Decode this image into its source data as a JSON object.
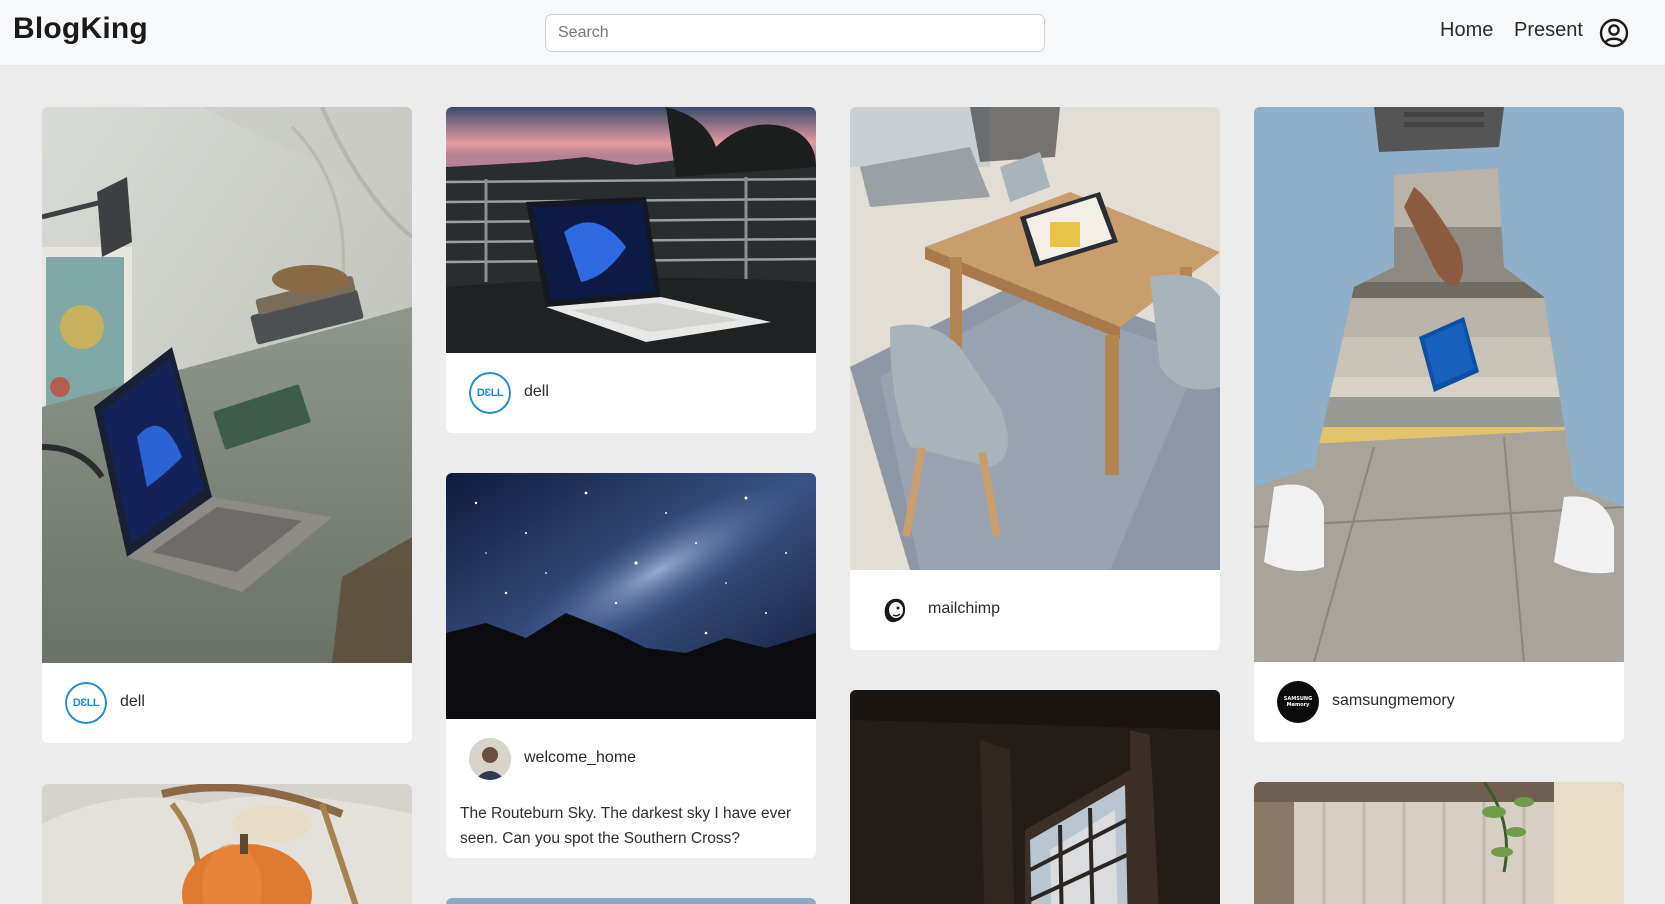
{
  "app": {
    "brand": "BlogKing"
  },
  "header": {
    "search_placeholder": "Search",
    "nav": {
      "home": "Home",
      "present": "Present"
    }
  },
  "posts": [
    {
      "author": "dell",
      "avatar": "dell-logo-icon"
    },
    {
      "author": "dell",
      "avatar": "dell-logo-icon"
    },
    {
      "author": "welcome_home",
      "avatar": "user-photo",
      "description": "The Routeburn Sky. The darkest sky I have ever seen. Can you spot the Southern Cross?"
    },
    {
      "author": "mailchimp",
      "avatar": "mailchimp-logo-icon"
    },
    {
      "author": "samsungmemory",
      "avatar": "samsung-memory-logo-icon",
      "avatar_text": "SAMSUNG Memory"
    }
  ],
  "colors": {
    "page_bg": "#ececec",
    "navbar_bg": "#f7f8fa",
    "dell_blue": "#1b8bd4"
  }
}
